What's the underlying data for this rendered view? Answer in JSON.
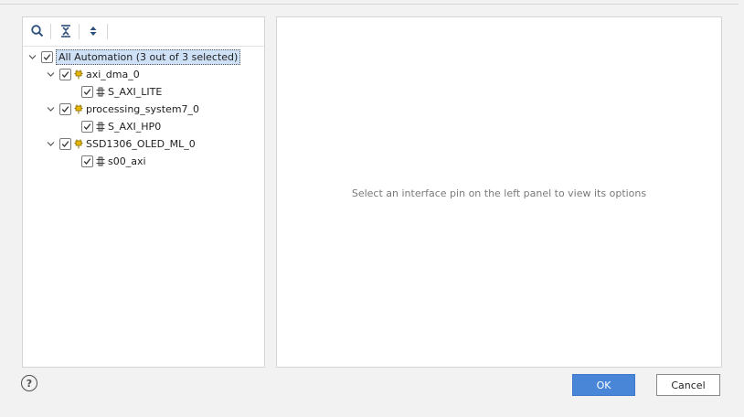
{
  "toolbar": {
    "icons": [
      "search-icon",
      "collapse-all-icon",
      "expand-all-icon"
    ]
  },
  "tree": {
    "root": {
      "label": "All Automation (3 out of 3 selected)",
      "checked": true,
      "expanded": true
    },
    "children": [
      {
        "label": "axi_dma_0",
        "checked": true,
        "expanded": true,
        "icon": "ip-block-icon",
        "children": [
          {
            "label": "S_AXI_LITE",
            "checked": true,
            "icon": "interface-pin-icon"
          }
        ]
      },
      {
        "label": "processing_system7_0",
        "checked": true,
        "expanded": true,
        "icon": "ip-block-icon",
        "children": [
          {
            "label": "S_AXI_HP0",
            "checked": true,
            "icon": "interface-pin-icon"
          }
        ]
      },
      {
        "label": "SSD1306_OLED_ML_0",
        "checked": true,
        "expanded": true,
        "icon": "ip-block-icon",
        "children": [
          {
            "label": "s00_axi",
            "checked": true,
            "icon": "interface-pin-icon"
          }
        ]
      }
    ]
  },
  "right_panel": {
    "placeholder": "Select an interface pin on the left panel to view its options"
  },
  "footer": {
    "help_label": "?",
    "ok_label": "OK",
    "cancel_label": "Cancel"
  },
  "colors": {
    "accent": "#4a86d8",
    "selection": "#cfe1f7",
    "ip_icon": "#e8b800"
  }
}
